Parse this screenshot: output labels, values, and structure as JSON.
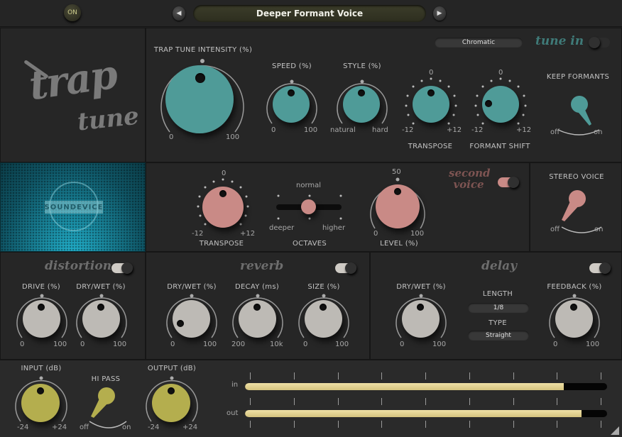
{
  "topbar": {
    "power_label": "ON",
    "preset_name": "Deeper Formant Voice",
    "prev_icon": "◀",
    "next_icon": "▶"
  },
  "brand": {
    "logo_line1": "trap",
    "logo_line2": "tune",
    "company": "SOUNDEVICE"
  },
  "main": {
    "intensity": {
      "label": "TRAP TUNE INTENSITY (%)",
      "min": "0",
      "max": "100",
      "value_pct": 50
    },
    "speed": {
      "label": "SPEED (%)",
      "min": "0",
      "max": "100",
      "value_pct": 50
    },
    "style": {
      "label": "STYLE (%)",
      "min": "natural",
      "max": "hard",
      "value_pct": 50
    },
    "scale_dropdown": "Chromatic",
    "tune_in_label": "tune in",
    "tune_in_on": false,
    "transpose": {
      "label": "TRANSPOSE",
      "min": "-12",
      "max": "+12",
      "center": "0",
      "value": 0
    },
    "formant_shift": {
      "label": "FORMANT SHIFT",
      "min": "-12",
      "max": "+12",
      "center": "0",
      "value": -6
    },
    "keep_formants": {
      "label": "KEEP FORMANTS",
      "off": "off",
      "on": "on",
      "state": "on"
    }
  },
  "second_voice": {
    "title_line1": "second",
    "title_line2": "voice",
    "enabled": true,
    "transpose": {
      "label": "TRANSPOSE",
      "min": "-12",
      "max": "+12",
      "center": "0",
      "value": 0
    },
    "octaves": {
      "label": "OCTAVES",
      "left": "deeper",
      "center": "normal",
      "right": "higher",
      "value": "normal"
    },
    "level": {
      "label": "LEVEL (%)",
      "min": "0",
      "max": "100",
      "center": "50",
      "value_pct": 50
    },
    "stereo_voice": {
      "label": "STEREO VOICE",
      "off": "off",
      "on": "on",
      "state": "off"
    }
  },
  "distortion": {
    "title": "distortion",
    "enabled": true,
    "drive": {
      "label": "DRIVE (%)",
      "min": "0",
      "max": "100",
      "value_pct": 50
    },
    "drywet": {
      "label": "DRY/WET (%)",
      "min": "0",
      "max": "100",
      "value_pct": 50
    }
  },
  "reverb": {
    "title": "reverb",
    "enabled": true,
    "drywet": {
      "label": "DRY/WET (%)",
      "min": "0",
      "max": "100",
      "value_pct": 15
    },
    "decay": {
      "label": "DECAY (ms)",
      "min": "200",
      "max": "10k",
      "value_pct": 50
    },
    "size": {
      "label": "SIZE (%)",
      "min": "0",
      "max": "100",
      "value_pct": 50
    }
  },
  "delay": {
    "title": "delay",
    "enabled": true,
    "drywet": {
      "label": "DRY/WET (%)",
      "min": "0",
      "max": "100",
      "value_pct": 50
    },
    "length_label": "LENGTH",
    "length_value": "1/8",
    "type_label": "TYPE",
    "type_value": "Straight",
    "feedback": {
      "label": "FEEDBACK (%)",
      "min": "0",
      "max": "100",
      "value_pct": 50
    }
  },
  "io": {
    "input": {
      "label": "INPUT (dB)",
      "min": "-24",
      "max": "+24",
      "value_pct": 50
    },
    "hipass": {
      "label": "HI PASS",
      "off": "off",
      "on": "on",
      "state": "off"
    },
    "output": {
      "label": "OUTPUT (dB)",
      "min": "-24",
      "max": "+24",
      "value_pct": 50
    },
    "meter_in_label": "in",
    "meter_out_label": "out",
    "meter_in_level_pct": 88,
    "meter_out_level_pct": 93
  },
  "colors": {
    "teal": "#4f9b98",
    "pink": "#c98a86",
    "grey": "#bdbab5",
    "olive": "#b4ae4e",
    "meter": "#e6d594"
  }
}
